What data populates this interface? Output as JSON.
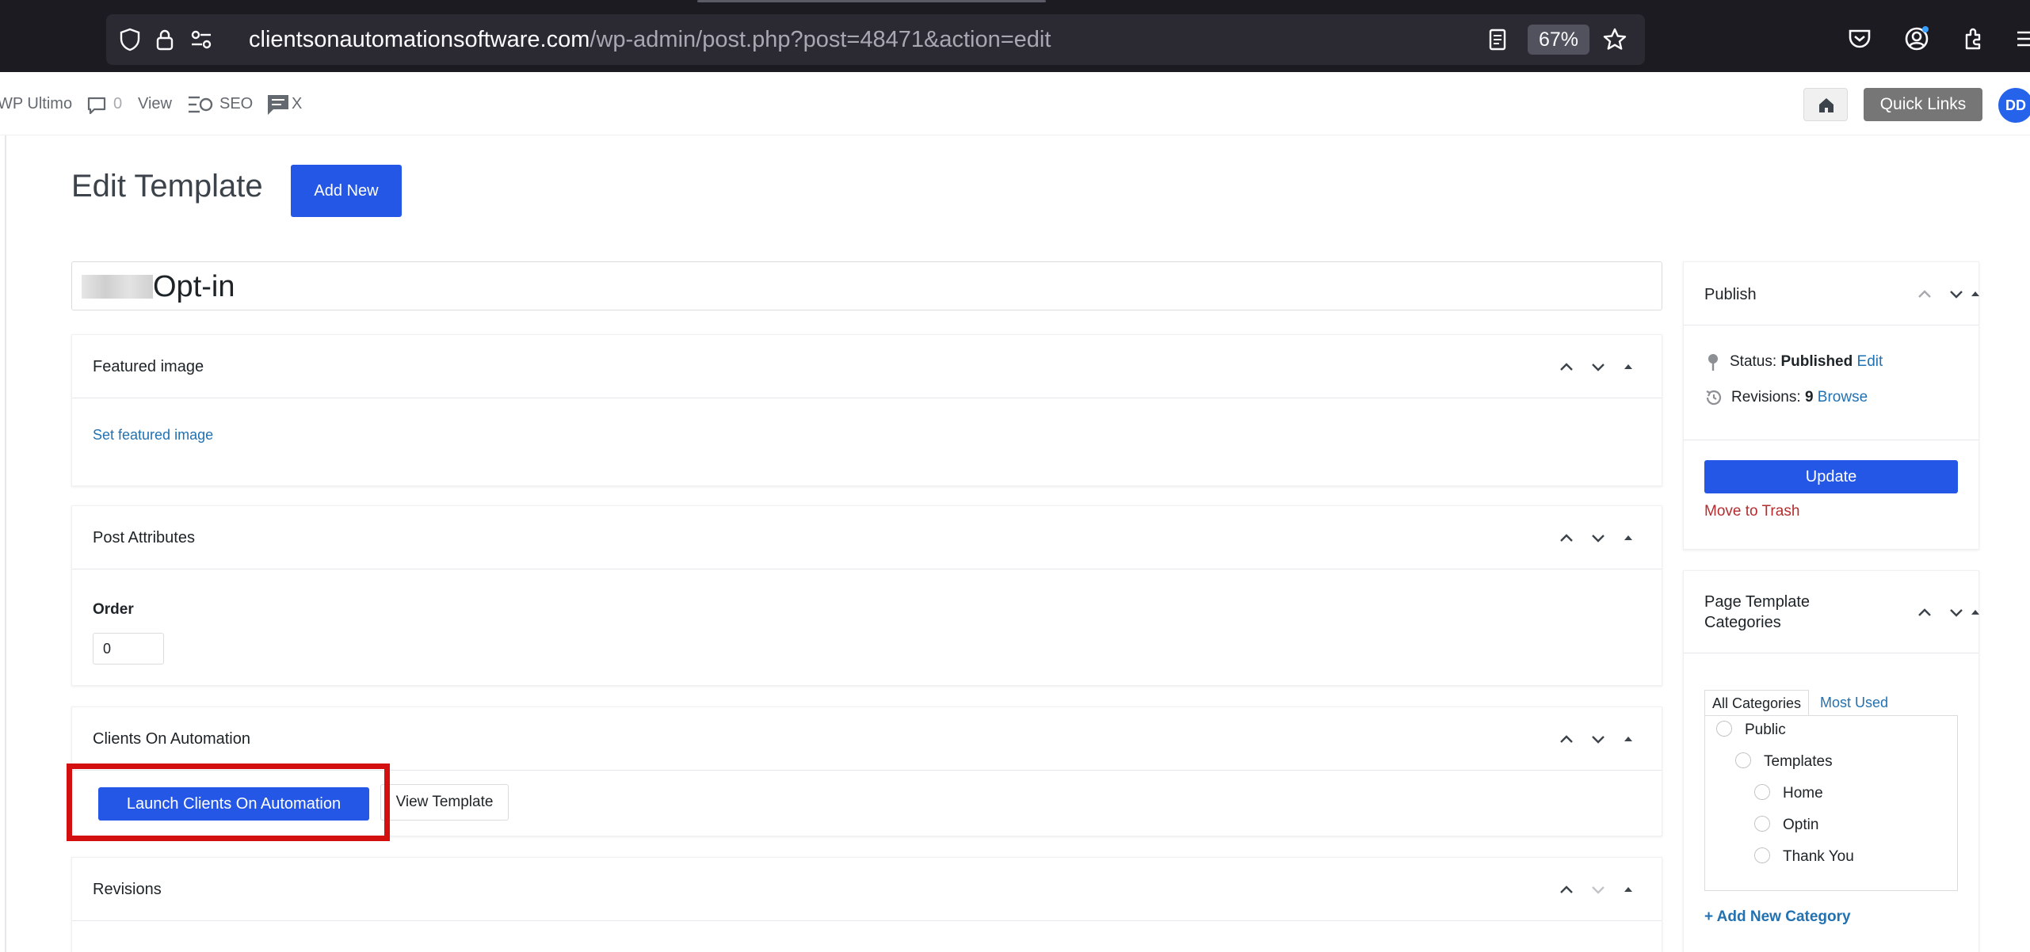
{
  "browser": {
    "url_host": "clientsonautomationsoftware.com",
    "url_path": "/wp-admin/post.php?post=48471&action=edit",
    "zoom": "67%"
  },
  "admin_bar": {
    "site_name": "WP Ultimo",
    "comments_count": "0",
    "view_label": "View",
    "seo_label": "SEO",
    "x_label": "X",
    "quick_links_label": "Quick Links",
    "avatar_initials": "DD"
  },
  "page": {
    "title": "Edit Template",
    "add_new_label": "Add New",
    "post_title": "Opt-in"
  },
  "featured_image": {
    "title": "Featured image",
    "set_link": "Set featured image"
  },
  "post_attributes": {
    "title": "Post Attributes",
    "order_label": "Order",
    "order_value": "0"
  },
  "clients_on_automation": {
    "title": "Clients On Automation",
    "launch_label": "Launch Clients On Automation",
    "view_template_label": "View Template"
  },
  "revisions_box": {
    "title": "Revisions"
  },
  "publish": {
    "title": "Publish",
    "status_label": "Status:",
    "status_value": "Published",
    "status_edit": "Edit",
    "revisions_label": "Revisions:",
    "revisions_count": "9",
    "revisions_browse": "Browse",
    "update_label": "Update",
    "trash_label": "Move to Trash"
  },
  "categories": {
    "title_line1": "Page Template",
    "title_line2": "Categories",
    "tab_all": "All Categories",
    "tab_most_used": "Most Used",
    "items": [
      "Public",
      "Templates",
      "Home",
      "Optin",
      "Thank You"
    ],
    "add_new": "+ Add New Category"
  },
  "colors": {
    "primary_button": "#2457e6",
    "link": "#2271b1",
    "highlight_box": "#d40f0f",
    "trash": "#b32d2e"
  }
}
